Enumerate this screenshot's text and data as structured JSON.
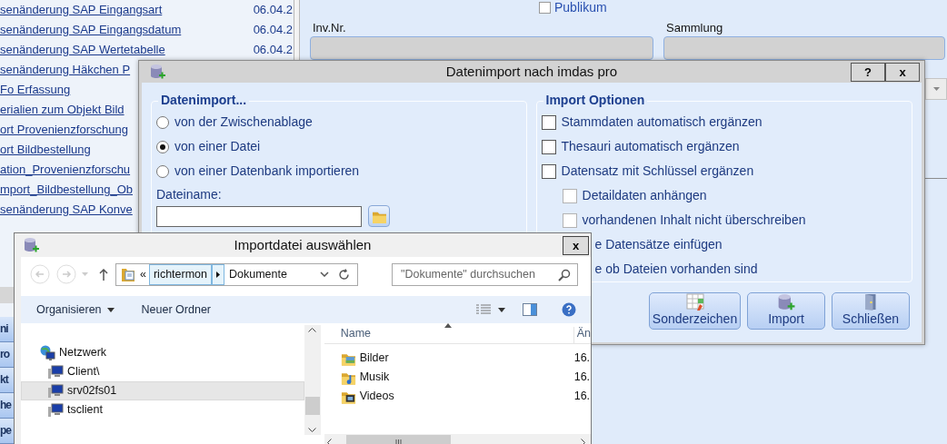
{
  "background_list": {
    "rows": [
      {
        "title": "senänderung SAP Eingangsart",
        "date": "06.04.2"
      },
      {
        "title": "senänderung SAP Eingangsdatum",
        "date": "06.04.2"
      },
      {
        "title": "senänderung SAP Wertetabelle",
        "date": "06.04.2"
      },
      {
        "title": "senänderung Häkchen P"
      },
      {
        "title": "Fo Erfassung"
      },
      {
        "title": "erialien zum Objekt Bild"
      },
      {
        "title": "ort Provenienzforschung"
      },
      {
        "title": "ort Bildbestellung"
      },
      {
        "title": "ation_Provenienzforschu"
      },
      {
        "title": "mport_Bildbestellung_Ob"
      },
      {
        "title": "senänderung SAP Konve"
      }
    ]
  },
  "background_tabs": [
    "ni",
    "ro",
    "kt",
    "he",
    "pe"
  ],
  "record_form": {
    "publikum": {
      "label": "Publikum",
      "checked": false
    },
    "fields": [
      {
        "label": "Inv.Nr."
      },
      {
        "label": "Sammlung"
      }
    ]
  },
  "import_dialog": {
    "title": "Datenimport nach imdas pro",
    "help_button": "?",
    "close_button": "x",
    "source_group": {
      "legend": "Datenimport...",
      "options": [
        {
          "label": "von der Zwischenablage",
          "selected": false
        },
        {
          "label": "von einer Datei",
          "selected": true
        },
        {
          "label": "von einer Datenbank importieren",
          "selected": false
        }
      ],
      "filename_label": "Dateiname:"
    },
    "options_group": {
      "legend": "Import Optionen",
      "options": [
        {
          "label": "Stammdaten automatisch ergänzen",
          "checked": false,
          "disabled": false
        },
        {
          "label": "Thesauri automatisch ergänzen",
          "checked": false,
          "disabled": false
        },
        {
          "label": "Datensatz mit Schlüssel ergänzen",
          "checked": false,
          "disabled": false,
          "children": [
            {
              "label": "Detaildaten anhängen",
              "checked": false,
              "disabled": true
            },
            {
              "label": "vorhandenen Inhalt nicht überschreiben",
              "checked": false,
              "disabled": true
            }
          ]
        }
      ],
      "covered_options": [
        "e Datensätze einfügen",
        "e ob Dateien vorhanden sind"
      ]
    },
    "buttons": [
      {
        "label": "Sonderzeichen",
        "kind": "chars"
      },
      {
        "label": "Import",
        "kind": "import"
      },
      {
        "label": "Schließen",
        "kind": "exit"
      }
    ]
  },
  "file_dialog": {
    "title": "Importdatei auswählen",
    "close_button": "x",
    "breadcrumb": {
      "overflow": "«",
      "segments": [
        {
          "label": "richtermon",
          "selected": true
        },
        {
          "label": "Dokumente",
          "selected": false
        }
      ]
    },
    "search": {
      "placeholder": "\"Dokumente\" durchsuchen"
    },
    "commands": [
      "Organisieren",
      "Neuer Ordner"
    ],
    "tree": [
      {
        "label": "Netzwerk",
        "kind": "network",
        "selected": false,
        "children": [
          {
            "label": "Client\\",
            "kind": "computer",
            "selected": false
          },
          {
            "label": "srv02fs01",
            "kind": "computer",
            "selected": true
          },
          {
            "label": "tsclient",
            "kind": "computer",
            "selected": false
          }
        ]
      }
    ],
    "file_columns": [
      "Name",
      "Än"
    ],
    "files": [
      {
        "name": "Bilder",
        "date": "16.",
        "kind": "pictures"
      },
      {
        "name": "Musik",
        "date": "16.",
        "kind": "music"
      },
      {
        "name": "Videos",
        "date": "16.",
        "kind": "videos"
      }
    ]
  }
}
